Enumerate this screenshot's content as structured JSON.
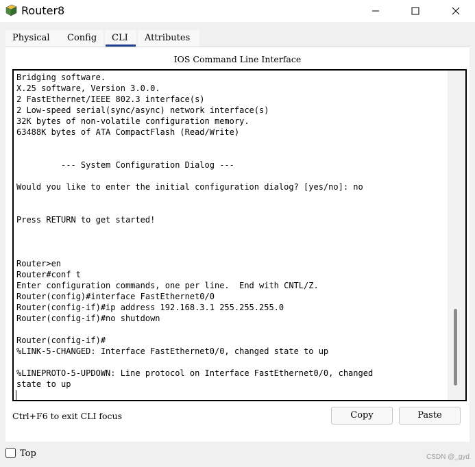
{
  "window": {
    "title": "Router8",
    "minimize_glyph": "—",
    "maximize_glyph": "☐",
    "close_glyph": "✕",
    "icon": "router-icon"
  },
  "tabs": [
    {
      "label": "Physical"
    },
    {
      "label": "Config"
    },
    {
      "label": "CLI",
      "active": true
    },
    {
      "label": "Attributes"
    }
  ],
  "cli": {
    "header": "IOS Command Line Interface",
    "output": "Bridging software.\nX.25 software, Version 3.0.0.\n2 FastEthernet/IEEE 802.3 interface(s)\n2 Low-speed serial(sync/async) network interface(s)\n32K bytes of non-volatile configuration memory.\n63488K bytes of ATA CompactFlash (Read/Write)\n\n\n         --- System Configuration Dialog ---\n\nWould you like to enter the initial configuration dialog? [yes/no]: no\n\n\nPress RETURN to get started!\n\n\n\nRouter>en\nRouter#conf t\nEnter configuration commands, one per line.  End with CNTL/Z.\nRouter(config)#interface FastEthernet0/0\nRouter(config-if)#ip address 192.168.3.1 255.255.255.0\nRouter(config-if)#no shutdown\n\nRouter(config-if)#\n%LINK-5-CHANGED: Interface FastEthernet0/0, changed state to up\n\n%LINEPROTO-5-UPDOWN: Line protocol on Interface FastEthernet0/0, changed\nstate to up",
    "exit_hint": "Ctrl+F6 to exit CLI focus",
    "copy_label": "Copy",
    "paste_label": "Paste"
  },
  "footer": {
    "top_label": "Top",
    "top_checked": false,
    "watermark": "CSDN @_gyd"
  },
  "colors": {
    "active_tab_underline": "#1f3c8f",
    "background": "#f0f0f0"
  }
}
